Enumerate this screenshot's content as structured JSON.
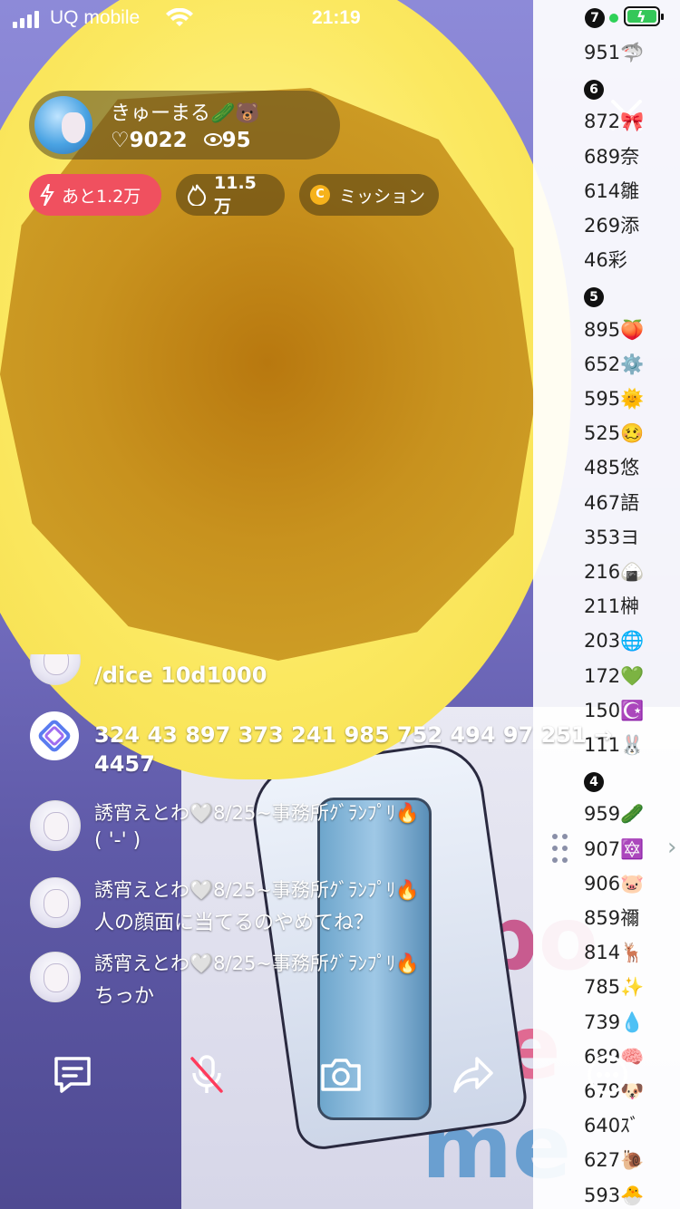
{
  "status_bar": {
    "carrier": "UQ mobile",
    "time": "21:19",
    "badge": "7"
  },
  "host": {
    "name": "きゅーまる🥒🐻",
    "likes": "♡9022",
    "viewers": "95"
  },
  "pills": {
    "remain": "あと1.2万",
    "points": "11.5万",
    "mission": "ミッション"
  },
  "ranking": [
    {
      "type": "value",
      "text": "951🦈"
    },
    {
      "type": "badge",
      "text": "6"
    },
    {
      "type": "value",
      "text": "872🎀"
    },
    {
      "type": "value",
      "text": "689奈"
    },
    {
      "type": "value",
      "text": "614雛"
    },
    {
      "type": "value",
      "text": "269添"
    },
    {
      "type": "value",
      "text": "46彩"
    },
    {
      "type": "badge",
      "text": "5"
    },
    {
      "type": "value",
      "text": "895🍑"
    },
    {
      "type": "value",
      "text": "652⚙️"
    },
    {
      "type": "value",
      "text": "595🌞"
    },
    {
      "type": "value",
      "text": "525🥴"
    },
    {
      "type": "value",
      "text": "485悠"
    },
    {
      "type": "value",
      "text": "467語"
    },
    {
      "type": "value",
      "text": "353ヨ"
    },
    {
      "type": "value",
      "text": "216🍙"
    },
    {
      "type": "value",
      "text": "211榊"
    },
    {
      "type": "value",
      "text": "203🌐"
    },
    {
      "type": "value",
      "text": "172💚"
    },
    {
      "type": "value",
      "text": "150☪️"
    },
    {
      "type": "value",
      "text": "111🐰"
    },
    {
      "type": "badge",
      "text": "4"
    },
    {
      "type": "value",
      "text": "959🥒"
    },
    {
      "type": "value",
      "text": "907🔯"
    },
    {
      "type": "value",
      "text": "906🐷"
    },
    {
      "type": "value",
      "text": "859禰"
    },
    {
      "type": "value",
      "text": "814🦌"
    },
    {
      "type": "value",
      "text": "785✨"
    },
    {
      "type": "value",
      "text": "739💧"
    },
    {
      "type": "value",
      "text": "689🧠"
    },
    {
      "type": "value",
      "text": "679🐶"
    },
    {
      "type": "value",
      "text": "640ｽﾞ"
    },
    {
      "type": "value",
      "text": "627🐌"
    },
    {
      "type": "value",
      "text": "593🐣"
    }
  ],
  "chat": {
    "dice_command": "/dice 10d1000",
    "dice_result_line1": "324 43 897 373 241 985 752 494 97 251 →",
    "dice_result_line2": "4457",
    "messages": [
      {
        "user": "誘宵えとわ🤍8/25~事務所ｸﾞﾗﾝﾌﾟﾘ🔥",
        "text": "( '-'  )"
      },
      {
        "user": "誘宵えとわ🤍8/25~事務所ｸﾞﾗﾝﾌﾟﾘ🔥",
        "text": "人の顔面に当てるのやめてね？"
      },
      {
        "user": "誘宵えとわ🤍8/25~事務所ｸﾞﾗﾝﾌﾟﾘ🔥",
        "text": "ちっか"
      }
    ]
  },
  "wall_text": {
    "line1": "bo",
    "line2": "ue",
    "line3": "me"
  },
  "icons": {
    "comment": "comment-icon",
    "mic": "mic-muted-icon",
    "camera": "camera-icon",
    "share": "share-icon",
    "more": "more-icon"
  }
}
